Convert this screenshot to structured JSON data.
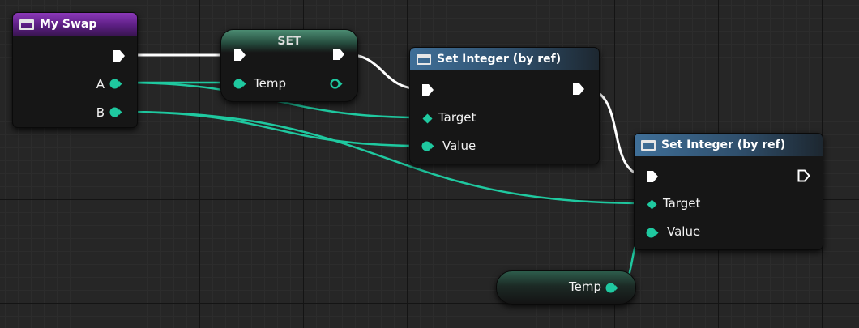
{
  "nodes": {
    "my_swap": {
      "title": "My Swap",
      "pins": {
        "a": "A",
        "b": "B"
      }
    },
    "set_node": {
      "title": "SET",
      "pins": {
        "temp": "Temp"
      }
    },
    "set_integer_1": {
      "title": "Set Integer (by ref)",
      "pins": {
        "target": "Target",
        "value": "Value"
      }
    },
    "set_integer_2": {
      "title": "Set Integer (by ref)",
      "pins": {
        "target": "Target",
        "value": "Value"
      }
    },
    "get_temp": {
      "label": "Temp"
    }
  },
  "colors": {
    "exec_wire": "#ffffff",
    "integer_wire": "#1fc9a0",
    "entry_header": "#6a2a96",
    "function_header": "#35597a",
    "variable_header": "#3b7a62"
  },
  "icons": {
    "function": "function-icon",
    "exec_pin": "exec-pin-icon",
    "integer_pin": "integer-pin-icon",
    "reference_pin": "ref-diamond-icon"
  }
}
